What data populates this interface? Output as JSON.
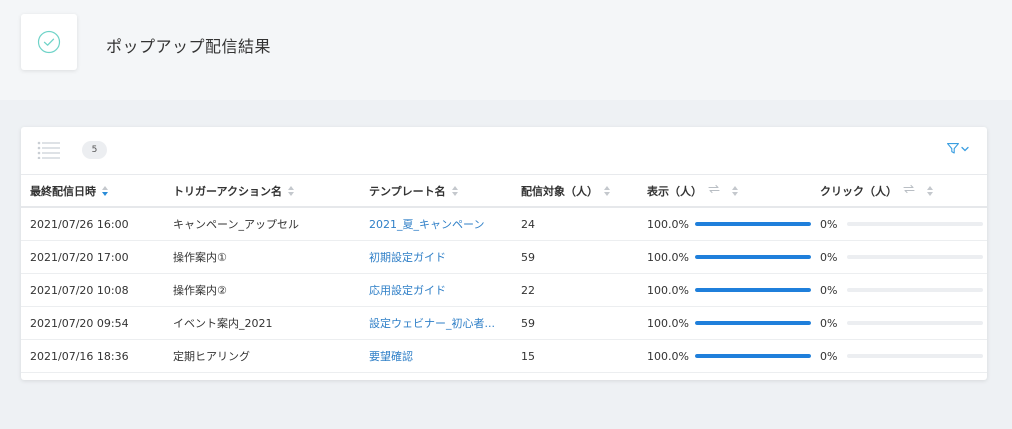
{
  "header": {
    "title": "ポップアップ配信結果",
    "icon": "check-circle-icon",
    "accent": "#6fd3c8"
  },
  "toolbar": {
    "count": "5",
    "list_icon": "list-view-icon",
    "filter_icon": "filter-icon"
  },
  "table": {
    "columns": [
      {
        "key": "sent_at",
        "label": "最終配信日時"
      },
      {
        "key": "trigger",
        "label": "トリガーアクション名"
      },
      {
        "key": "template",
        "label": "テンプレート名"
      },
      {
        "key": "target",
        "label": "配信対象（人）"
      },
      {
        "key": "views",
        "label": "表示（人）"
      },
      {
        "key": "clicks",
        "label": "クリック（人）"
      }
    ],
    "rows": [
      {
        "sent_at": "2021/07/26 16:00",
        "trigger": "キャンペーン_アップセル",
        "template": "2021_夏_キャンペーン",
        "target": "24",
        "views_pct": "100.0%",
        "views_ratio": 1.0,
        "clicks_pct": "0%",
        "clicks_ratio": 0
      },
      {
        "sent_at": "2021/07/20 17:00",
        "trigger": "操作案内①",
        "template": "初期設定ガイド",
        "target": "59",
        "views_pct": "100.0%",
        "views_ratio": 1.0,
        "clicks_pct": "0%",
        "clicks_ratio": 0
      },
      {
        "sent_at": "2021/07/20 10:08",
        "trigger": "操作案内②",
        "template": "応用設定ガイド",
        "target": "22",
        "views_pct": "100.0%",
        "views_ratio": 1.0,
        "clicks_pct": "0%",
        "clicks_ratio": 0
      },
      {
        "sent_at": "2021/07/20 09:54",
        "trigger": "イベント案内_2021",
        "template": "設定ウェビナー_初心者...",
        "target": "59",
        "views_pct": "100.0%",
        "views_ratio": 1.0,
        "clicks_pct": "0%",
        "clicks_ratio": 0
      },
      {
        "sent_at": "2021/07/16 18:36",
        "trigger": "定期ヒアリング",
        "template": "要望確認",
        "target": "15",
        "views_pct": "100.0%",
        "views_ratio": 1.0,
        "clicks_pct": "0%",
        "clicks_ratio": 0
      }
    ]
  },
  "colors": {
    "bar_fill": "#1f7fdb",
    "bar_track": "#eceef1",
    "link": "#2f7fc7",
    "sort_active": "#2a8cd8"
  }
}
